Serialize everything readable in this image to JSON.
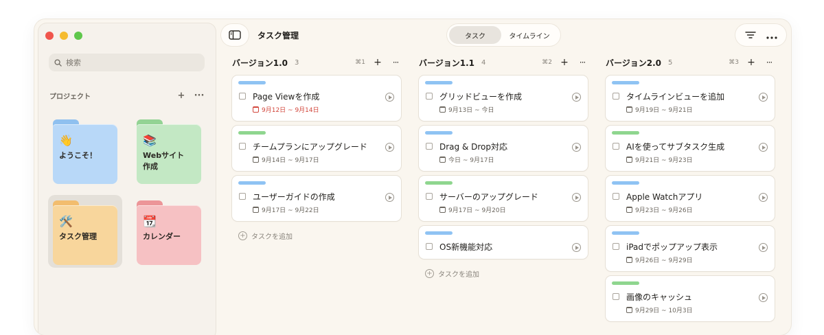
{
  "window": {
    "title": "タスク管理",
    "view_tabs": [
      {
        "label": "タスク",
        "active": true
      },
      {
        "label": "タイムライン",
        "active": false
      }
    ]
  },
  "sidebar": {
    "search_placeholder": "検索",
    "projects_header": "プロジェクト",
    "add_label": "+",
    "more_label": "···",
    "projects": [
      {
        "emoji": "👋",
        "name": "ようこそ！",
        "color": "#b8d8f8",
        "tab_color": "#8fc0ef"
      },
      {
        "emoji": "📚",
        "name": "Webサイト\n作成",
        "color": "#c3e8c4",
        "tab_color": "#93d394"
      },
      {
        "emoji": "🛠️",
        "name": "タスク管理",
        "color": "#f8d69c",
        "tab_color": "#f2bd6e",
        "selected": true
      },
      {
        "emoji": "📆",
        "name": "カレンダー",
        "color": "#f6c1c3",
        "tab_color": "#ec9598"
      }
    ]
  },
  "columns": [
    {
      "title": "バージョン1.0",
      "count": "3",
      "shortcut": "⌘1",
      "add_task": "タスクを追加",
      "cards": [
        {
          "tag_color": "#8fc3f3",
          "title": "Page Viewを作成",
          "date": "9月12日 ~ 9月14日",
          "overdue": true
        },
        {
          "tag_color": "#8fd68f",
          "title": "チームプランにアップグレード",
          "date": "9月14日 ~ 9月17日"
        },
        {
          "tag_color": "#8fc3f3",
          "title": "ユーザーガイドの作成",
          "date": "9月17日 ~ 9月22日"
        }
      ]
    },
    {
      "title": "バージョン1.1",
      "count": "4",
      "shortcut": "⌘2",
      "add_task": "タスクを追加",
      "cards": [
        {
          "tag_color": "#8fc3f3",
          "title": "グリッドビューを作成",
          "date": "9月13日 ~ 今日"
        },
        {
          "tag_color": "#8fc3f3",
          "title": "Drag & Drop対応",
          "date": "今日 ~ 9月17日"
        },
        {
          "tag_color": "#8fd68f",
          "title": "サーバーのアップグレード",
          "date": "9月17日 ~ 9月20日"
        },
        {
          "tag_color": "#8fc3f3",
          "title": "OS新機能対応",
          "date": ""
        }
      ]
    },
    {
      "title": "バージョン2.0",
      "count": "5",
      "shortcut": "⌘3",
      "add_task": "",
      "cards": [
        {
          "tag_color": "#8fc3f3",
          "title": "タイムラインビューを追加",
          "date": "9月19日 ~ 9月21日"
        },
        {
          "tag_color": "#8fd68f",
          "title": "AIを使ってサブタスク生成",
          "date": "9月21日 ~ 9月23日"
        },
        {
          "tag_color": "#8fc3f3",
          "title": "Apple Watchアプリ",
          "date": "9月23日 ~ 9月26日"
        },
        {
          "tag_color": "#8fc3f3",
          "title": "iPadでポップアップ表示",
          "date": "9月26日 ~ 9月29日"
        },
        {
          "tag_color": "#8fd68f",
          "title": "画像のキャッシュ",
          "date": "9月29日 ~ 10月3日"
        }
      ]
    }
  ]
}
